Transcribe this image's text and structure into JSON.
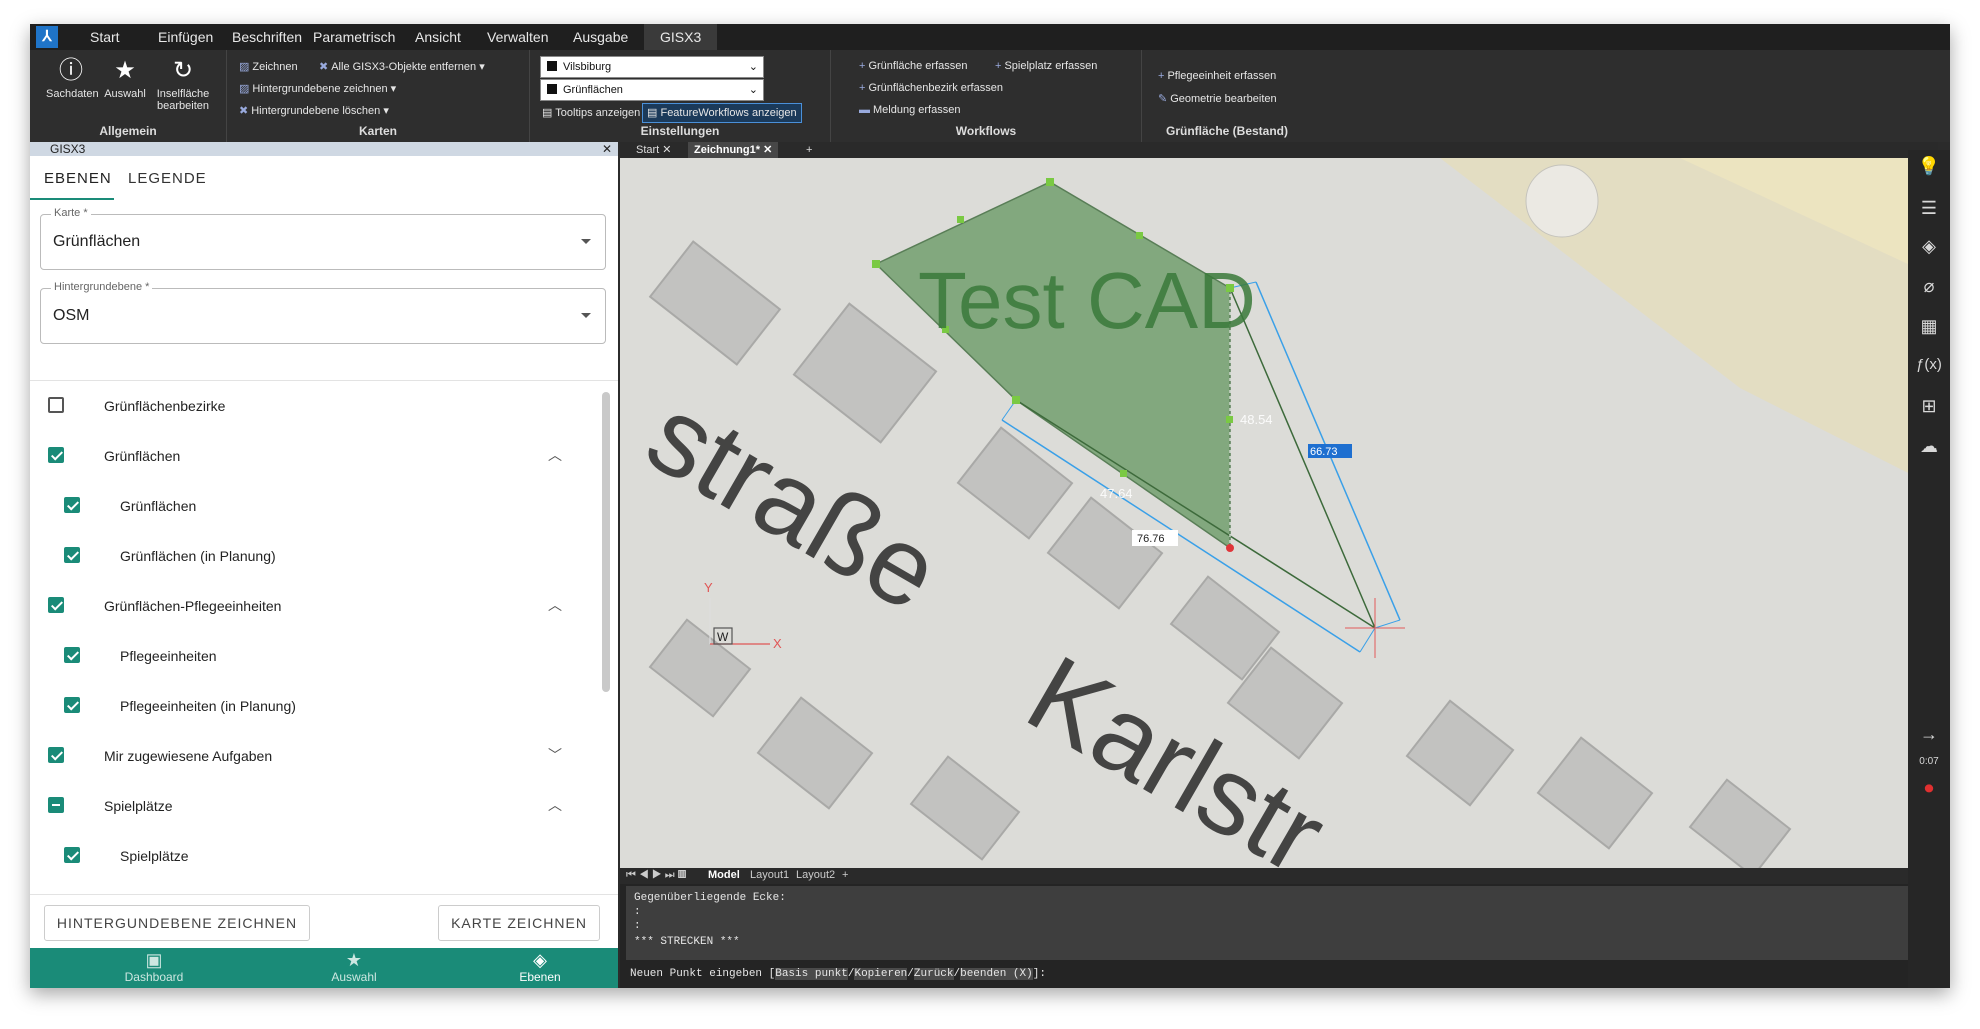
{
  "menu": {
    "items": [
      "Start",
      "Einfügen",
      "Beschriften",
      "Parametrisch",
      "Ansicht",
      "Verwalten",
      "Ausgabe"
    ],
    "active": "GISX3"
  },
  "ribbon": {
    "allgemein": {
      "title": "Allgemein",
      "buttons": [
        {
          "icon": "info-icon",
          "label": "Sachdaten"
        },
        {
          "icon": "star-icon",
          "label": "Auswahl"
        },
        {
          "icon": "refresh-icon",
          "label": "Inselfläche bearbeiten"
        }
      ]
    },
    "karten": {
      "title": "Karten",
      "zeichnen": "Zeichnen",
      "entfernen": "Alle GISX3-Objekte entfernen",
      "hg_zeichnen": "Hintergrundebene zeichnen",
      "hg_loeschen": "Hintergrundebene löschen"
    },
    "einstellungen": {
      "title": "Einstellungen",
      "combo1": "Vilsbiburg",
      "combo2": "Grünflächen",
      "tooltips": "Tooltips anzeigen",
      "featureworkflows": "FeatureWorkflows anzeigen"
    },
    "workflows": {
      "title": "Workflows",
      "gruenflaeche": "Grünfläche erfassen",
      "spielplatz": "Spielplatz erfassen",
      "bezirk": "Grünflächenbezirk erfassen",
      "meldung": "Meldung erfassen"
    },
    "bestand": {
      "title": "Grünfläche (Bestand)",
      "pflege": "Pflegeeinheit erfassen",
      "geometrie": "Geometrie bearbeiten"
    }
  },
  "panel": {
    "title": "GISX3",
    "tabs": [
      "EBENEN",
      "LEGENDE"
    ],
    "karte_label": "Karte *",
    "karte_value": "Grünflächen",
    "hg_label": "Hintergrundebene *",
    "hg_value": "OSM",
    "layers": [
      {
        "label": "Grünflächenbezirke",
        "state": "off",
        "indent": false,
        "chevron": ""
      },
      {
        "label": "Grünflächen",
        "state": "on",
        "indent": false,
        "chevron": "^"
      },
      {
        "label": "Grünflächen",
        "state": "on",
        "indent": true,
        "chevron": ""
      },
      {
        "label": "Grünflächen (in Planung)",
        "state": "on",
        "indent": true,
        "chevron": ""
      },
      {
        "label": "Grünflächen-Pflegeeinheiten",
        "state": "on",
        "indent": false,
        "chevron": "^"
      },
      {
        "label": "Pflegeeinheiten",
        "state": "on",
        "indent": true,
        "chevron": ""
      },
      {
        "label": "Pflegeeinheiten (in Planung)",
        "state": "on",
        "indent": true,
        "chevron": ""
      },
      {
        "label": "Mir zugewiesene Aufgaben",
        "state": "on",
        "indent": false,
        "chevron": "v"
      },
      {
        "label": "Spielplätze",
        "state": "ind",
        "indent": false,
        "chevron": "^"
      },
      {
        "label": "Spielplätze",
        "state": "on",
        "indent": true,
        "chevron": ""
      }
    ],
    "btn_hg": "HINTERGUNDEBENE ZEICHNEN",
    "btn_karte": "KARTE ZEICHNEN",
    "nav": [
      {
        "icon": "clipboard-icon",
        "label": "Dashboard"
      },
      {
        "icon": "star-icon",
        "label": "Auswahl"
      },
      {
        "icon": "layers-icon",
        "label": "Ebenen"
      }
    ]
  },
  "doctabs": {
    "start": "Start",
    "drawing": "Zeichnung1*"
  },
  "canvas": {
    "cad_text": "Test CAD",
    "street1": "straße",
    "street2": "Karlstr",
    "dim1": "66.73",
    "dim2": "48.54",
    "dim3": "47.64",
    "dim4": "76.76",
    "ucs_y": "Y",
    "ucs_x": "X",
    "ucs_w": "W"
  },
  "layouts": {
    "model": "Model",
    "l1": "Layout1",
    "l2": "Layout2"
  },
  "command": {
    "line1": "Gegenüberliegende Ecke:",
    "line2": ":",
    "line3": ":",
    "line4": "*** STRECKEN ***",
    "prompt_pre": "Neuen Punkt eingeben [",
    "opt1": "Basis punkt",
    "opt2": "Kopieren",
    "opt3": "Zurück",
    "opt4": "beenden (X)",
    "prompt_post": "]:"
  },
  "recorder": {
    "time": "0:07"
  }
}
